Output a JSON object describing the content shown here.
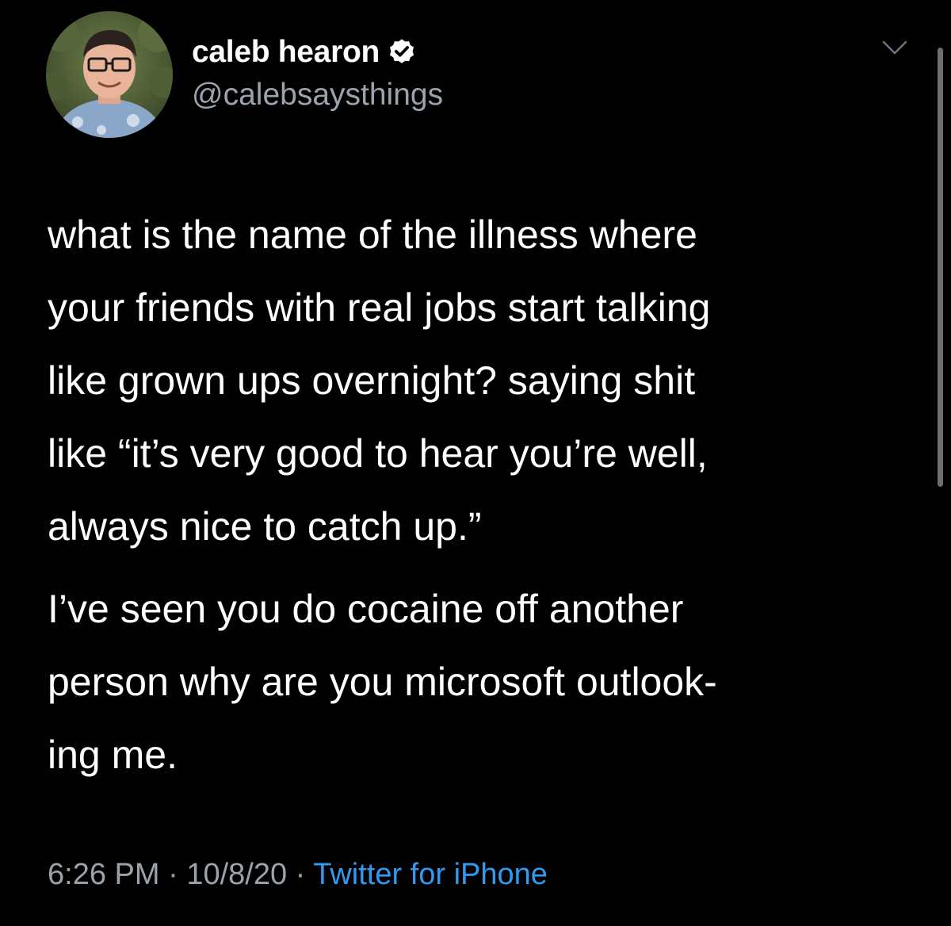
{
  "tweet": {
    "author": {
      "display_name": "caleb hearon",
      "handle": "@calebsaysthings",
      "avatar_icon": "avatar",
      "verified_icon": "verified-badge-icon"
    },
    "text_paragraph_1_lines": [
      "what is the name of the illness where",
      "your friends with real jobs start talking",
      "like grown ups overnight? saying shit",
      "like “it’s very good to hear you’re well,",
      "always nice to catch up.”"
    ],
    "text_paragraph_2_lines": [
      "I’ve seen you do cocaine off another",
      "person why are you microsoft outlook-",
      "ing me."
    ],
    "time": "6:26 PM",
    "date": "10/8/20",
    "separator": " · ",
    "source": "Twitter for iPhone"
  },
  "colors": {
    "background": "#000000",
    "text": "#ffffff",
    "secondary_text": "#9aa3ad",
    "link": "#2f9bf0"
  }
}
